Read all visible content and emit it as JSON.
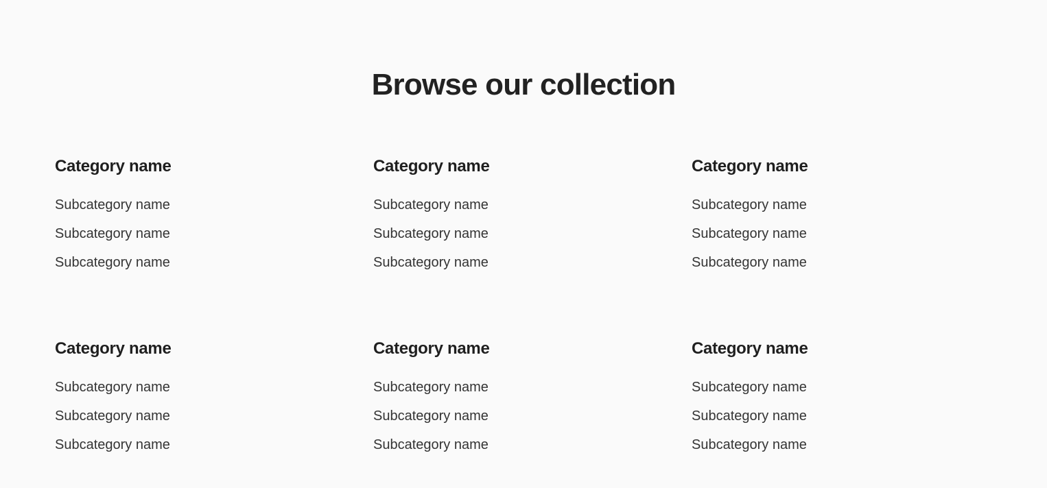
{
  "theme": {
    "background": "#fafafa",
    "title_color": "#222222",
    "heading_color": "#1f1f1f",
    "link_color": "#343434"
  },
  "header": {
    "title": "Browse our collection"
  },
  "collection": {
    "columns": 3,
    "rows": 2,
    "categories": [
      {
        "heading": "Category name",
        "subcategories": [
          {
            "label": "Subcategory name"
          },
          {
            "label": "Subcategory name"
          },
          {
            "label": "Subcategory name"
          }
        ]
      },
      {
        "heading": "Category name",
        "subcategories": [
          {
            "label": "Subcategory name"
          },
          {
            "label": "Subcategory name"
          },
          {
            "label": "Subcategory name"
          }
        ]
      },
      {
        "heading": "Category name",
        "subcategories": [
          {
            "label": "Subcategory name"
          },
          {
            "label": "Subcategory name"
          },
          {
            "label": "Subcategory name"
          }
        ]
      },
      {
        "heading": "Category name",
        "subcategories": [
          {
            "label": "Subcategory name"
          },
          {
            "label": "Subcategory name"
          },
          {
            "label": "Subcategory name"
          }
        ]
      },
      {
        "heading": "Category name",
        "subcategories": [
          {
            "label": "Subcategory name"
          },
          {
            "label": "Subcategory name"
          },
          {
            "label": "Subcategory name"
          }
        ]
      },
      {
        "heading": "Category name",
        "subcategories": [
          {
            "label": "Subcategory name"
          },
          {
            "label": "Subcategory name"
          },
          {
            "label": "Subcategory name"
          }
        ]
      }
    ]
  }
}
